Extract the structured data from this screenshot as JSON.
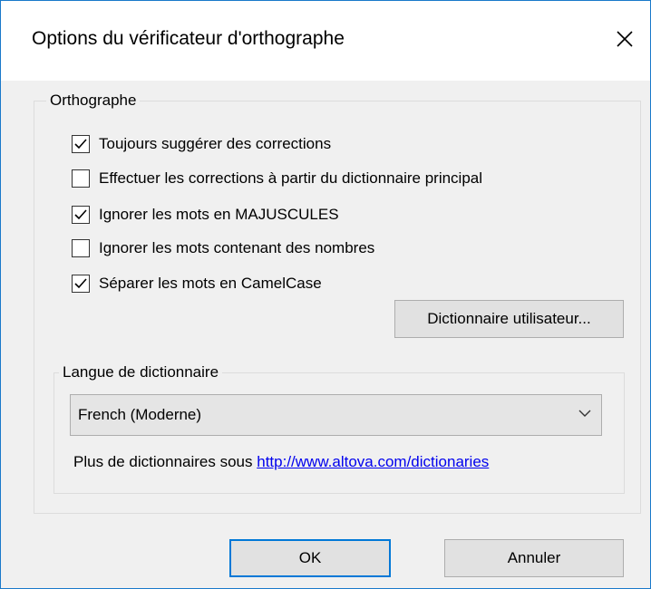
{
  "dialog": {
    "title": "Options du vérificateur d'orthographe",
    "close_icon": "close-icon"
  },
  "spelling_group": {
    "label": "Orthographe",
    "options": [
      {
        "label": "Toujours suggérer des corrections",
        "checked": true
      },
      {
        "label": "Effectuer les corrections à partir du dictionnaire principal",
        "checked": false
      },
      {
        "label": "Ignorer les mots en MAJUSCULES",
        "checked": true
      },
      {
        "label": "Ignorer les mots contenant des nombres",
        "checked": false
      },
      {
        "label": "Séparer les mots en CamelCase",
        "checked": true
      }
    ],
    "user_dict_button": "Dictionnaire utilisateur..."
  },
  "language_group": {
    "label": "Langue de dictionnaire",
    "selected_language": "French (Moderne)",
    "more_text": "Plus de dictionnaires sous ",
    "link_text": "http://www.altova.com/dictionaries"
  },
  "buttons": {
    "ok": "OK",
    "cancel": "Annuler"
  },
  "colors": {
    "accent": "#0078d7",
    "link": "#0000ee",
    "window_border": "#1979ca"
  }
}
